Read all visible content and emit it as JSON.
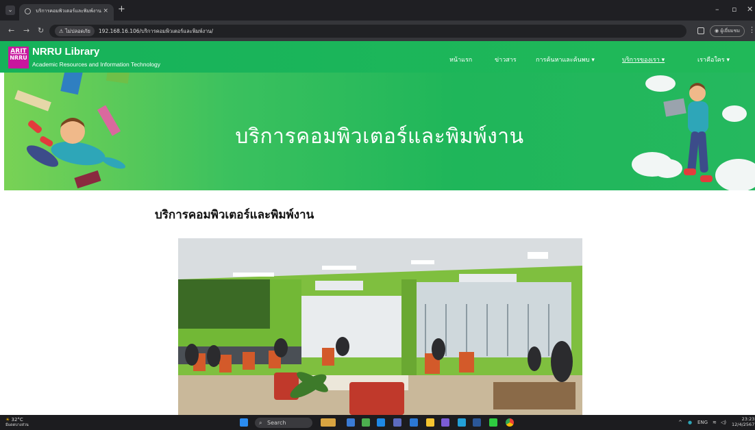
{
  "browser": {
    "tab_title": "บริการคอมพิวเตอร์และพิมพ์งาน – NR",
    "tab_close": "×",
    "new_tab": "+",
    "security_label": "ไม่ปลอดภัย",
    "url": "192.168.16.106/บริการคอมพิวเตอร์และพิมพ์งาน/",
    "profile_label": "ผู้เยี่ยมชม"
  },
  "site": {
    "logo_line1": "ARIT",
    "logo_line2": "NRRU",
    "title": "NRRU Library",
    "subtitle": "Academic Resources and Information Technology",
    "nav": [
      {
        "label": "หน้าแรก"
      },
      {
        "label": "ข่าวสาร"
      },
      {
        "label": "การค้นหาและค้นพบ ▾"
      },
      {
        "label": "บริการของเรา ▾"
      },
      {
        "label": "เราคือใคร ▾"
      }
    ]
  },
  "banner": {
    "title": "บริการคอมพิวเตอร์และพิมพ์งาน"
  },
  "content": {
    "heading": "บริการคอมพิวเตอร์และพิมพ์งาน"
  },
  "taskbar": {
    "temperature": "32°C",
    "weather_text": "มีแดดบางส่วน",
    "search_label": "Search",
    "lang": "ENG",
    "time": "23:23",
    "date": "12/4/2567"
  },
  "colors": {
    "header_green": "#16b25a",
    "logo_magenta": "#c8169e"
  }
}
